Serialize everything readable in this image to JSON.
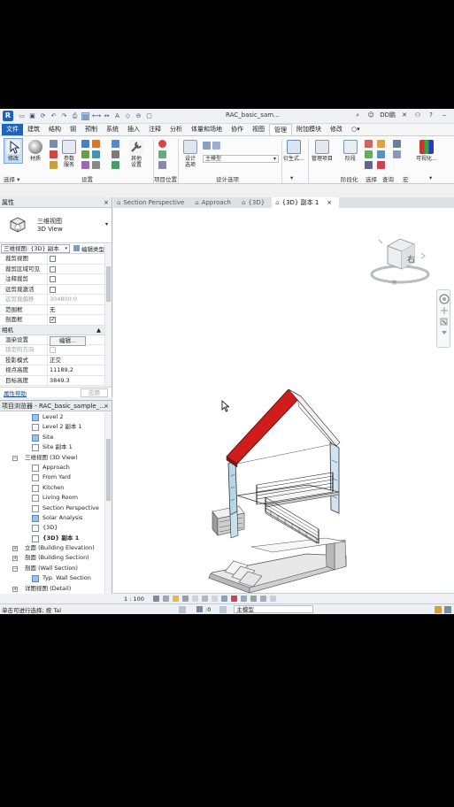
{
  "title_bar": {
    "window_title": "RAC_basic_sam...",
    "user": "DD鹏",
    "help": "?"
  },
  "ribbon_tabs": [
    "文件",
    "建筑",
    "结构",
    "钢",
    "预制",
    "系统",
    "插入",
    "注释",
    "分析",
    "体量和场地",
    "协作",
    "视图",
    "管理",
    "附加模块",
    "修改",
    "○▾"
  ],
  "ribbon": {
    "modify": "修改",
    "material": "材质",
    "params_top": "参数",
    "params_bottom": "服务",
    "other_top": "其他",
    "other_bottom": "设置",
    "design_opt_top": "设计",
    "design_opt_bottom": "选项",
    "main_model": "主模型",
    "derive": "衍生式...",
    "manage_project": "管理项目",
    "phase": "阶段",
    "visualize": "可视化...",
    "select_label": "选择 ▾",
    "settings_label": "设置",
    "location_label": "项目位置",
    "design_options_label": "设计选项",
    "phasing_label": "阶段化",
    "select2_label": "选择",
    "inquiry_label": "查询",
    "macro_label": "宏",
    "dropdown_arrow": "▾"
  },
  "view_tabs": [
    {
      "label": "Section Perspective",
      "active": false
    },
    {
      "label": "Approach",
      "active": false
    },
    {
      "label": "{3D}",
      "active": false
    },
    {
      "label": "{3D} 副本 1",
      "active": true
    }
  ],
  "properties": {
    "header": "属性",
    "type_line1": "三维视图",
    "type_line2": "3D View",
    "instance": "三维视图: {3D} 副本",
    "edit_type": "编辑类型",
    "rows": [
      {
        "k": "裁剪视图",
        "v": "",
        "cb": "off"
      },
      {
        "k": "裁剪区域可见",
        "v": "",
        "cb": "off"
      },
      {
        "k": "注释裁剪",
        "v": "",
        "cb": "off"
      },
      {
        "k": "远剪裁激活",
        "v": "",
        "cb": "off"
      },
      {
        "k": "远剪裁偏移",
        "v": "304800.0",
        "dim": true
      },
      {
        "k": "范围框",
        "v": "无"
      },
      {
        "k": "剖面框",
        "v": "",
        "cb": "on"
      }
    ],
    "camera_header": "相机",
    "camera_arrow": "▲",
    "render_settings": "渲染设置",
    "render_button": "编辑...",
    "rows2": [
      {
        "k": "锁定的方向",
        "v": "",
        "cb": "dis",
        "dim": true
      },
      {
        "k": "投影模式",
        "v": "正交"
      },
      {
        "k": "视点高度",
        "v": "11189.2"
      },
      {
        "k": "目标高度",
        "v": "3849.3"
      }
    ],
    "help_link": "属性帮助",
    "apply": "应用"
  },
  "project_browser": {
    "header": "项目浏览器 - RAC_basic_sample_...",
    "nodes": [
      {
        "label": "Level 2",
        "indent": 2,
        "type": "blue"
      },
      {
        "label": "Level 2 副本 1",
        "indent": 2,
        "type": "white"
      },
      {
        "label": "Site",
        "indent": 2,
        "type": "blue"
      },
      {
        "label": "Site 副本 1",
        "indent": 2,
        "type": "white"
      },
      {
        "label": "三维视图 (3D View)",
        "indent": 1,
        "type": "toggle",
        "toggle": "−"
      },
      {
        "label": "Approach",
        "indent": 2,
        "type": "white"
      },
      {
        "label": "From Yard",
        "indent": 2,
        "type": "white"
      },
      {
        "label": "Kitchen",
        "indent": 2,
        "type": "white"
      },
      {
        "label": "Living Room",
        "indent": 2,
        "type": "white"
      },
      {
        "label": "Section Perspective",
        "indent": 2,
        "type": "white"
      },
      {
        "label": "Solar Analysis",
        "indent": 2,
        "type": "blue"
      },
      {
        "label": "{3D}",
        "indent": 2,
        "type": "white"
      },
      {
        "label": "{3D} 副本 1",
        "indent": 2,
        "type": "white",
        "bold": true
      },
      {
        "label": "立面 (Building Elevation)",
        "indent": 1,
        "type": "toggle",
        "toggle": "+"
      },
      {
        "label": "剖面 (Building Section)",
        "indent": 1,
        "type": "toggle",
        "toggle": "+"
      },
      {
        "label": "剖面 (Wall Section)",
        "indent": 1,
        "type": "toggle",
        "toggle": "−"
      },
      {
        "label": "Typ. Wall Section",
        "indent": 2,
        "type": "blue"
      },
      {
        "label": "详图视图 (Detail)",
        "indent": 1,
        "type": "toggle",
        "toggle": "+"
      }
    ]
  },
  "viewcube": {
    "face": "右",
    "compass": "前"
  },
  "view_control_bar": {
    "scale": "1 : 100"
  },
  "status_bar": {
    "message": "单击可进行选择; 按 Tal",
    "count": ":0",
    "model": "主模型"
  },
  "colors": {
    "accent": "#1f63c0",
    "roof": "#d11c1c",
    "glass": "#b8d6ea"
  }
}
